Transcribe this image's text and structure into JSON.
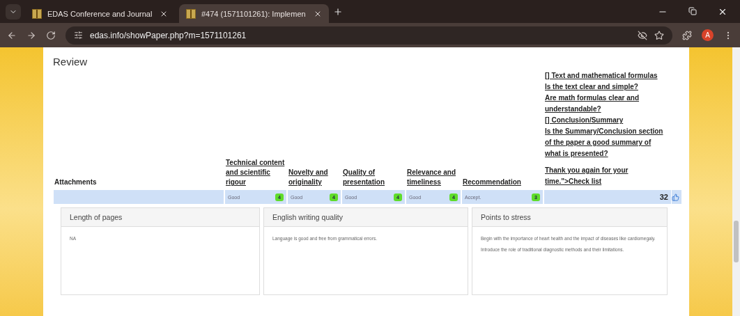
{
  "browser": {
    "tabs": [
      {
        "title": "EDAS Conference and Journal",
        "selected": false
      },
      {
        "title": "#474 (1571101261): Implemen",
        "selected": true
      }
    ],
    "url": "edas.info/showPaper.php?m=1571101261",
    "avatar": "A"
  },
  "review": {
    "title": "Review",
    "columns": [
      "Attachments",
      "Technical content and scientific rigour",
      "Novelty and originality",
      "Quality of presentation",
      "Relevance and timeliness",
      "Recommendation"
    ],
    "checklist": [
      "[] Text and mathematical formulas",
      "Is the text clear and simple?",
      "Are math formulas clear and understandable?",
      "[] Conclusion/Summary",
      "Is the Summary/Conclusion section of the paper a good summary of what is presented?",
      "Thank you again for your time.\">Check list"
    ],
    "row": {
      "ratings": [
        {
          "text": "Good",
          "score": "4"
        },
        {
          "text": "Good",
          "score": "4"
        },
        {
          "text": "Good",
          "score": "4"
        },
        {
          "text": "Good",
          "score": "4"
        },
        {
          "text": "Accept.",
          "score": "3"
        }
      ],
      "total": "32"
    },
    "cards": [
      {
        "title": "Length of pages",
        "paragraphs": [
          "NA"
        ]
      },
      {
        "title": "English writing quality",
        "paragraphs": [
          "Language is good and free from grammatical errors."
        ]
      },
      {
        "title": "Points to stress",
        "paragraphs": [
          "Begin with the importance of heart health and the impact of diseases like cardiomegaly.",
          "Introduce the role of traditional diagnostic methods and their limitations."
        ]
      }
    ]
  }
}
